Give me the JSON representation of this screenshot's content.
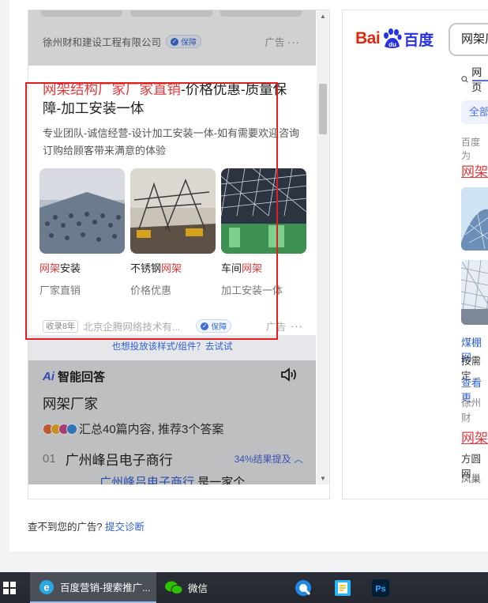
{
  "preview": {
    "prev_ad": {
      "company": "徐州财和建设工程有限公司",
      "badge": "保障",
      "ad_label": "广告",
      "more": "···"
    },
    "ad": {
      "title_hl": "网架结构厂家厂家直销",
      "title_rest": "-价格优惠-质量保障-加工安装一体",
      "desc": "专业团队-诚信经营-设计加工安装一体-如有需要欢迎咨询订购给顾客带来满意的体验",
      "items": [
        {
          "cap_hl": "网架",
          "cap_rest": "安装",
          "sub": "厂家直销"
        },
        {
          "cap_pre": "不锈钢",
          "cap_hl": "网架",
          "sub": "价格优惠"
        },
        {
          "cap_pre": "车间",
          "cap_hl": "网架",
          "sub": "加工安装一体"
        }
      ],
      "foot_tag": "收录8年",
      "foot_company": "北京企腾网络技术有...",
      "foot_badge": "保障",
      "foot_ad": "广告",
      "foot_more": "···"
    },
    "try_text": "也想投放该样式/组件？去试试",
    "ai": {
      "logo": "Ai",
      "title": "智能回答",
      "question": "网架厂家",
      "summary": "汇总40篇内容, 推荐3个答案",
      "item_num": "01",
      "item_text": "广州峰吕电子商行",
      "item_pct": "34%结果提及",
      "sub_link": "广州峰吕电子商行",
      "sub_rest": "是一家个"
    }
  },
  "serp": {
    "logo_bai": "Bai",
    "logo_du": "du",
    "logo_cn": "百度",
    "search_value": "网架厂",
    "tab": "网页",
    "filter": "全部",
    "note": "百度为",
    "title1": "网架",
    "t2": "煤棚网",
    "t3": "按需定",
    "t4": "查看更",
    "t5": "徐州财",
    "title2": "网架",
    "t6": "方圆网",
    "t7": "凤巢"
  },
  "bottom": {
    "note": "查不到您的广告?",
    "link": "提交诊断"
  },
  "taskbar": {
    "ie_label": "百度营销-搜索推广...",
    "wechat_label": "微信"
  }
}
